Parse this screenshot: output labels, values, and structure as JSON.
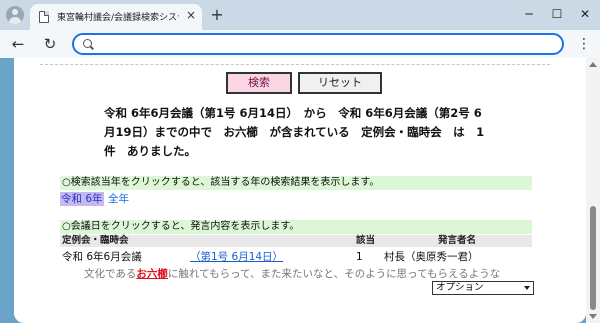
{
  "browser": {
    "tab_title": "東宮輪村議会/会議録検索システム",
    "tab_close": "×",
    "new_tab": "+",
    "minimize": "─",
    "maximize": "☐",
    "close": "✕",
    "back": "←",
    "reload": "↻",
    "menu": "⋮",
    "address_value": "",
    "accent": "#1a73e8"
  },
  "search": {
    "search_button": "検索",
    "reset_button": "リセット",
    "summary": "令和 6年6月会議（第1号 6月14日）　から　令和 6年6月会議（第2号 6月19日）までの中で　お六櫛　が含まれている　定例会・臨時会　は　1件　ありました。"
  },
  "year_section": {
    "instruction": "○検索該当年をクリックすると、該当する年の検索結果を表示します。",
    "current_year": "令和 6年",
    "all_years": "全年"
  },
  "results_section": {
    "instruction": "○会議日をクリックすると、発言内容を表示します。",
    "columns": {
      "session": "定例会・臨時会",
      "hits": "該当",
      "speaker": "発言者名"
    },
    "row": {
      "session": "令和 6年6月会議",
      "date_link": "（第1号 6月14日）",
      "hits": "1",
      "speaker": "村長（奥原秀一君）"
    },
    "snippet_before": "文化である",
    "snippet_keyword": "お六櫛",
    "snippet_after": "に触れてもらって、また来たいなと、そのように思ってもらえるような",
    "option_select": "オプション"
  },
  "colors": {
    "search_button_bg": "#fbd7e6",
    "section_bar_bg": "#dcf7d6",
    "keyword": "#e0141e",
    "link": "#1a5fd0"
  }
}
